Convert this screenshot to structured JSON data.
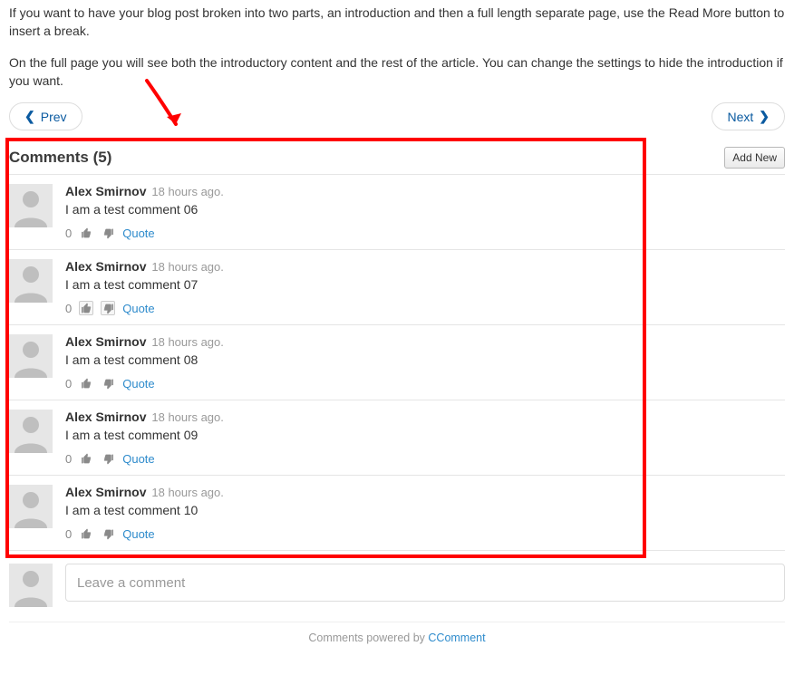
{
  "intro": {
    "p1": "If you want to have your blog post broken into two parts, an introduction and then a full length separate page, use the Read More button to insert a break.",
    "p2": "On the full page you will see both the introductory content and the rest of the article. You can change the settings to hide the introduction if you want."
  },
  "pager": {
    "prev": "Prev",
    "next": "Next"
  },
  "comments_header": {
    "label": "Comments",
    "count": 5
  },
  "add_new_label": "Add New",
  "quote_label": "Quote",
  "comments": [
    {
      "author": "Alex Smirnov",
      "time": "18 hours ago.",
      "text": "I am a test comment 06",
      "votes": 0,
      "boxed_thumbs": false
    },
    {
      "author": "Alex Smirnov",
      "time": "18 hours ago.",
      "text": "I am a test comment 07",
      "votes": 0,
      "boxed_thumbs": true
    },
    {
      "author": "Alex Smirnov",
      "time": "18 hours ago.",
      "text": "I am a test comment 08",
      "votes": 0,
      "boxed_thumbs": false
    },
    {
      "author": "Alex Smirnov",
      "time": "18 hours ago.",
      "text": "I am a test comment 09",
      "votes": 0,
      "boxed_thumbs": false
    },
    {
      "author": "Alex Smirnov",
      "time": "18 hours ago.",
      "text": "I am a test comment 10",
      "votes": 0,
      "boxed_thumbs": false
    }
  ],
  "leave_placeholder": "Leave a comment",
  "powered": {
    "prefix": "Comments powered by ",
    "brand": "CComment"
  },
  "annotation": {
    "arrow_color": "#ff0000",
    "highlight_color": "#ff0000"
  }
}
